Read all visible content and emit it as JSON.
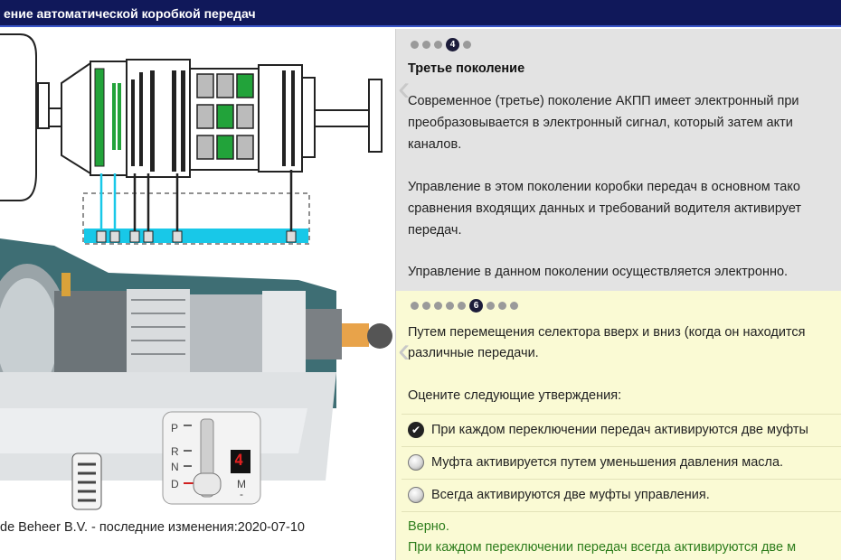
{
  "window": {
    "title": "ение автоматической коробкой передач"
  },
  "diagram": {
    "selector": {
      "gear_display": "4",
      "positions": [
        "P",
        "R",
        "N",
        "D"
      ],
      "manual_label": "M",
      "minus": "-"
    }
  },
  "footer": {
    "text": "de Beheer B.V. - последние изменения:2020-07-10"
  },
  "slide_top": {
    "dots_total": 5,
    "active_index": 3,
    "active_label": "4",
    "title": "Третье поколение",
    "paragraphs": [
      "Современное (третье) поколение АКПП имеет электронный при",
      "преобразовывается в электронный сигнал, который затем акти",
      "каналов.",
      "Управление в этом поколении коробки передач в основном тако",
      "сравнения входящих данных и требований водителя активирует",
      "передач.",
      "Управление в данном поколении осуществляется электронно."
    ]
  },
  "slide_bottom": {
    "dots_total": 9,
    "active_index": 5,
    "active_label": "6",
    "intro_line1": "Путем перемещения селектора вверх и вниз (когда он находится",
    "intro_line2": "различные передачи.",
    "question": "Оцените следующие утверждения:",
    "options": [
      {
        "label": "При каждом переключении передач активируются две муфты",
        "checked": true,
        "mark": "✔"
      },
      {
        "label": "Муфта активируется путем уменьшения давления масла.",
        "checked": false
      },
      {
        "label": "Всегда активируются две муфты управления.",
        "checked": false
      }
    ],
    "result_title": "Верно.",
    "result_text": "При каждом переключении передач всегда активируются две м"
  },
  "colors": {
    "title_bar": "#10185a",
    "panel_gray": "#e3e3e3",
    "panel_yellow": "#fafad4",
    "correct_green": "#2d7d1c",
    "clutch_green": "#22a33a",
    "hydraulic_cyan": "#18c8e8",
    "housing_teal": "#3e6e74"
  }
}
